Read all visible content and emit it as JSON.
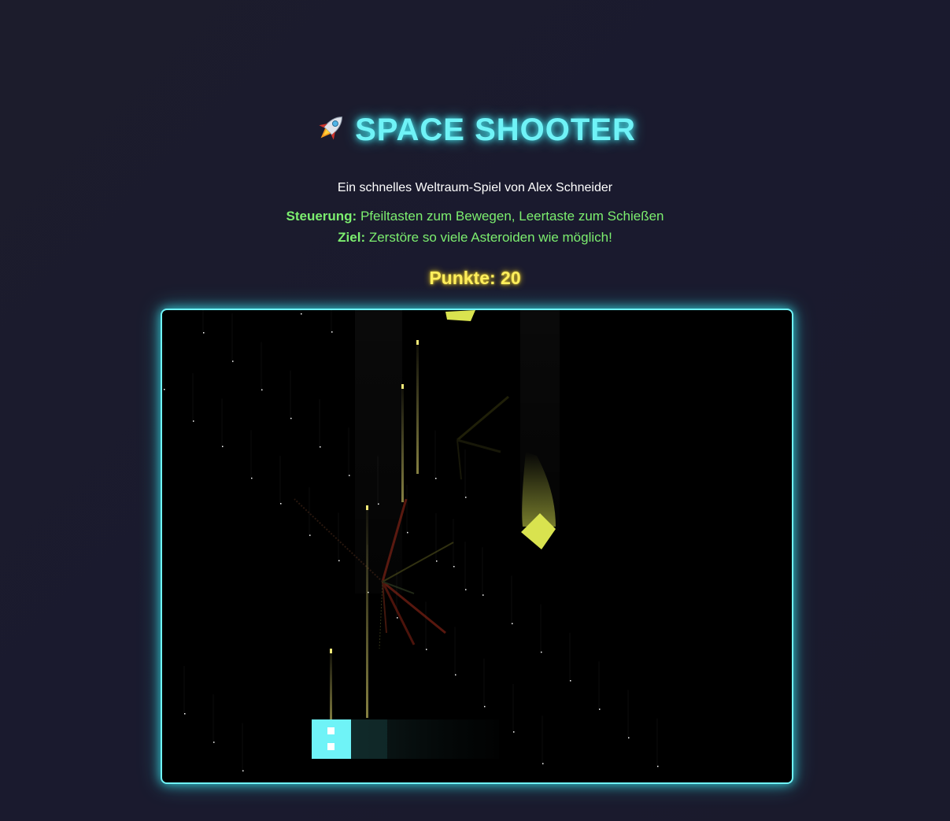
{
  "header": {
    "title": "SPACE SHOOTER",
    "subtitle": "Ein schnelles Weltraum-Spiel von Alex Schneider"
  },
  "instructions": {
    "controls_label": "Steuerung:",
    "controls_text": " Pfeiltasten zum Bewegen, Leertaste zum Schießen",
    "goal_label": "Ziel:",
    "goal_text": " Zerstöre so viele Asteroiden wie möglich!"
  },
  "score": {
    "text": "Punkte: 20"
  },
  "colors": {
    "accent": "#6ff3f7",
    "instructions": "#7cee6f",
    "score": "#ffef5c",
    "asteroid": "#d9e34f",
    "bullet": "#f2e978",
    "explosion": "#c23a1e"
  },
  "game": {
    "player_icon": "player-ship-icon",
    "asteroid_icon": "asteroid-icon",
    "bullet_icon": "bullet-icon",
    "star_icon": "star-icon"
  }
}
